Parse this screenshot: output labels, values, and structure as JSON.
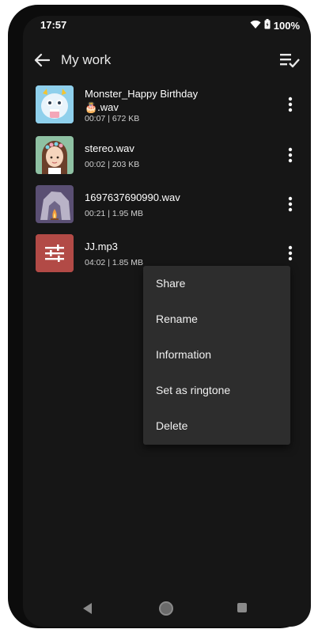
{
  "status_bar": {
    "time": "17:57",
    "battery": "100%",
    "icons": [
      "wifi-icon",
      "battery-icon"
    ]
  },
  "app_bar": {
    "title": "My work",
    "back_icon": "arrow-left-icon",
    "action_icon": "select-all-icon"
  },
  "files": [
    {
      "name_line1": "Monster_Happy Birthday",
      "name_line2": "🎂.wav",
      "duration": "00:07",
      "size": "672 KB",
      "thumb": "monster-thumbnail"
    },
    {
      "name_line1": "stereo.wav",
      "name_line2": "",
      "duration": "00:02",
      "size": "203 KB",
      "thumb": "girl-thumbnail"
    },
    {
      "name_line1": "1697637690990.wav",
      "name_line2": "",
      "duration": "00:21",
      "size": "1.95 MB",
      "thumb": "cave-fire-thumbnail"
    },
    {
      "name_line1": "JJ.mp3",
      "name_line2": "",
      "duration": "04:02",
      "size": "1.85 MB",
      "thumb": "equalizer-thumbnail"
    }
  ],
  "meta_separator": " | ",
  "context_menu": {
    "items": [
      "Share",
      "Rename",
      "Information",
      "Set as ringtone",
      "Delete"
    ]
  },
  "colors": {
    "background": "#161616",
    "menu_background": "#2d2d2d",
    "text_primary": "#ffffff",
    "equalizer_thumb": "#b24a46"
  },
  "nav_bar": {
    "icons": [
      "nav-back-icon",
      "nav-home-icon",
      "nav-recents-icon"
    ]
  }
}
